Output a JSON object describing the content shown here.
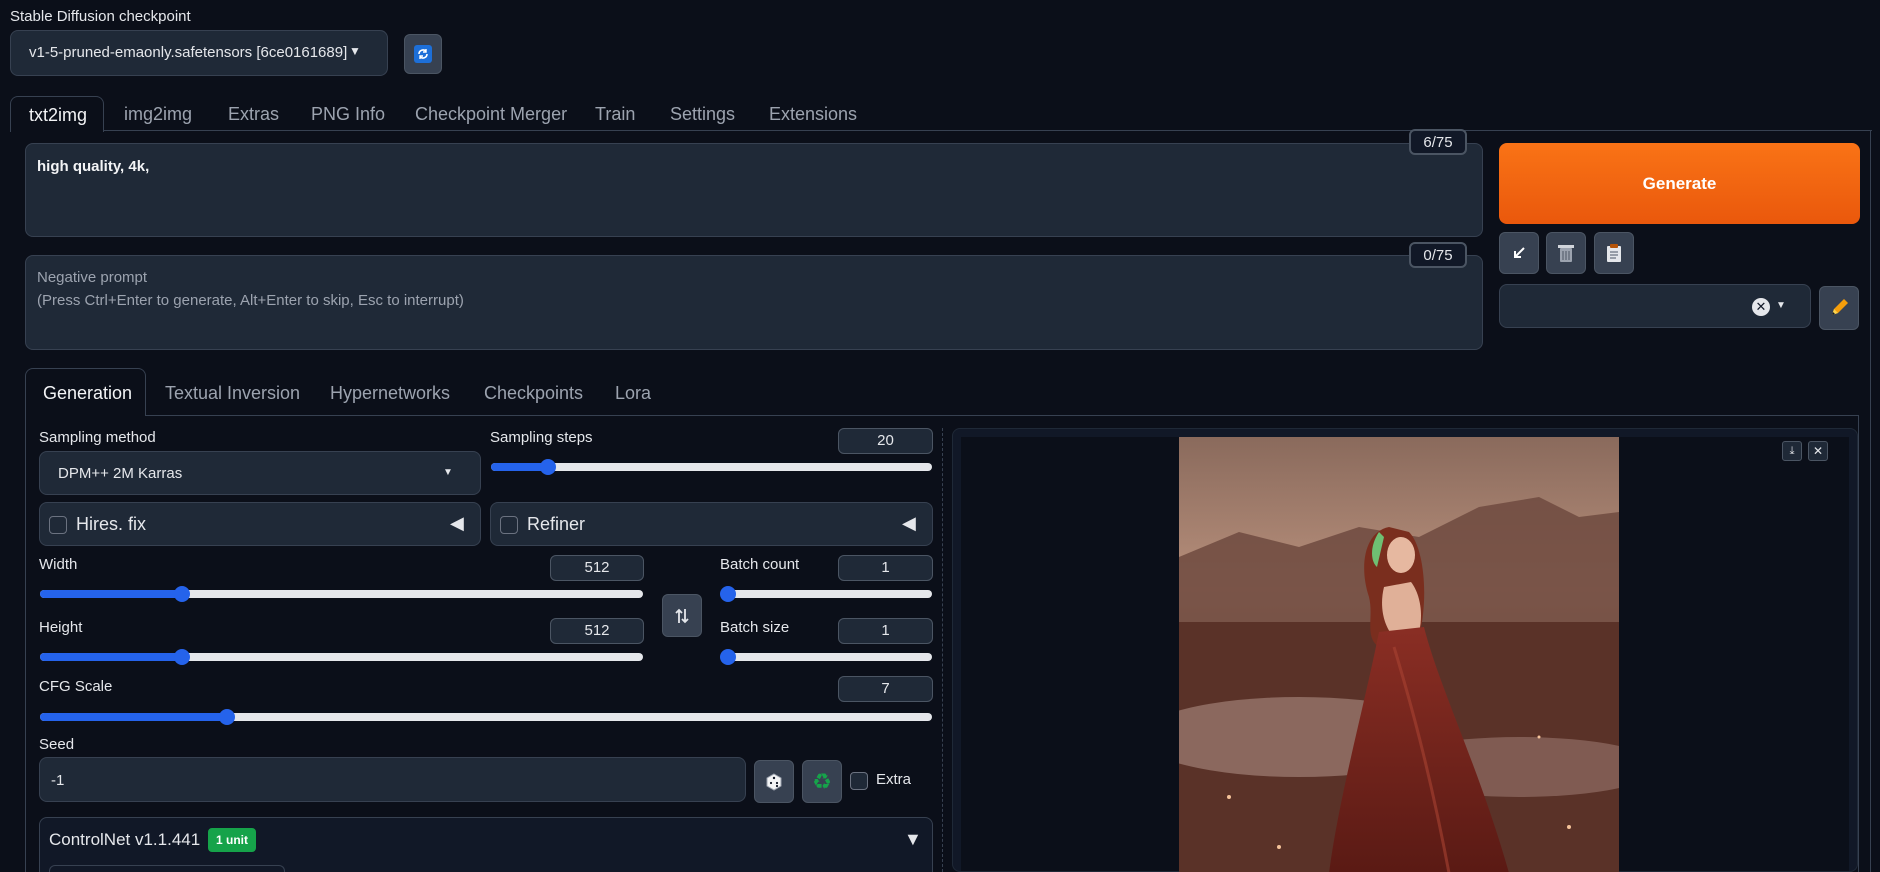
{
  "checkpoint": {
    "label": "Stable Diffusion checkpoint",
    "value": "v1-5-pruned-emaonly.safetensors [6ce0161689]"
  },
  "main_tabs": [
    "txt2img",
    "img2img",
    "Extras",
    "PNG Info",
    "Checkpoint Merger",
    "Train",
    "Settings",
    "Extensions"
  ],
  "prompt": {
    "value": "high quality, 4k,",
    "token_count": "6/75"
  },
  "negative_prompt": {
    "placeholder_line1": "Negative prompt",
    "placeholder_line2": "(Press Ctrl+Enter to generate, Alt+Enter to skip, Esc to interrupt)",
    "token_count": "0/75"
  },
  "generate": {
    "label": "Generate",
    "color": "#f97316"
  },
  "sub_tabs": [
    "Generation",
    "Textual Inversion",
    "Hypernetworks",
    "Checkpoints",
    "Lora"
  ],
  "sampling": {
    "method_label": "Sampling method",
    "method_value": "DPM++ 2M Karras",
    "steps_label": "Sampling steps",
    "steps_value": "20",
    "steps_fraction": 0.13
  },
  "hires": {
    "label": "Hires. fix"
  },
  "refiner": {
    "label": "Refiner"
  },
  "width": {
    "label": "Width",
    "value": "512",
    "fraction": 0.235
  },
  "height": {
    "label": "Height",
    "value": "512",
    "fraction": 0.235
  },
  "batch_count": {
    "label": "Batch count",
    "value": "1",
    "fraction": 0.0
  },
  "batch_size": {
    "label": "Batch size",
    "value": "1",
    "fraction": 0.0
  },
  "cfg": {
    "label": "CFG Scale",
    "value": "7",
    "fraction": 0.21
  },
  "seed": {
    "label": "Seed",
    "value": "-1",
    "extra_label": "Extra"
  },
  "controlnet": {
    "label": "ControlNet v1.1.441",
    "badge": "1 unit",
    "badge_color": "#16a34a"
  },
  "icons": {
    "refresh": "refresh-icon",
    "arrow": "arrow-icon",
    "trash": "trash-icon",
    "clipboard": "clipboard-icon",
    "pencil": "pencil-icon",
    "swap": "swap-icon",
    "dice": "dice-icon",
    "recycle": "recycle-icon"
  }
}
